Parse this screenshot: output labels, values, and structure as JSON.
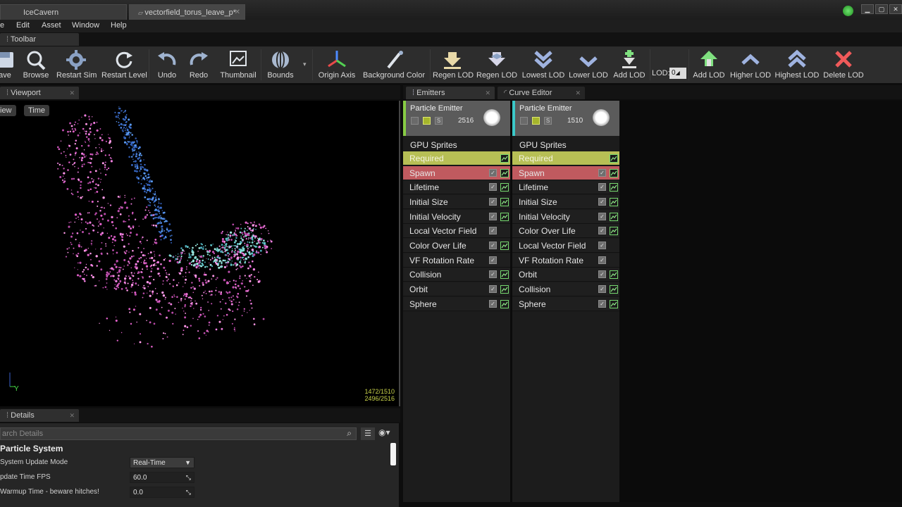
{
  "titlebar": {
    "tabs": [
      "IceCavern",
      "vectorfield_torus_leave_p*"
    ],
    "window_buttons": [
      "minimize",
      "maximize",
      "close"
    ]
  },
  "menu": {
    "items": [
      "e",
      "Edit",
      "Asset",
      "Window",
      "Help"
    ]
  },
  "toolbar": {
    "tab_label": "Toolbar",
    "buttons": [
      {
        "label": "ave",
        "icon": "save-icon"
      },
      {
        "label": "Browse",
        "icon": "browse-icon"
      },
      {
        "label": "Restart Sim",
        "icon": "restart-sim-icon"
      },
      {
        "label": "Restart Level",
        "icon": "restart-level-icon"
      },
      {
        "label": "Undo",
        "icon": "undo-icon"
      },
      {
        "label": "Redo",
        "icon": "redo-icon"
      },
      {
        "label": "Thumbnail",
        "icon": "thumbnail-icon"
      },
      {
        "label": "Bounds",
        "icon": "bounds-icon"
      },
      {
        "label": "Origin Axis",
        "icon": "origin-axis-icon"
      },
      {
        "label": "Background Color",
        "icon": "background-color-icon"
      },
      {
        "label": "Regen LOD",
        "icon": "regen-lod-icon"
      },
      {
        "label": "Regen LOD",
        "icon": "regen-lod-duplicate-icon"
      },
      {
        "label": "Lowest LOD",
        "icon": "lowest-lod-icon"
      },
      {
        "label": "Lower LOD",
        "icon": "lower-lod-icon"
      },
      {
        "label": "Add LOD",
        "icon": "add-lod-icon"
      },
      {
        "label": "Add LOD",
        "icon": "add-lod-higher-icon"
      },
      {
        "label": "Higher LOD",
        "icon": "higher-lod-icon"
      },
      {
        "label": "Highest LOD",
        "icon": "highest-lod-icon"
      },
      {
        "label": "Delete LOD",
        "icon": "delete-lod-icon"
      }
    ],
    "lod_label": "LOD:",
    "lod_value": "0"
  },
  "viewport": {
    "tab_label": "Viewport",
    "view_button": "iew",
    "time_button": "Time",
    "axis_label": "Y",
    "stats": [
      "1472/1510",
      "2496/2516"
    ]
  },
  "details": {
    "tab_label": "Details",
    "search_placeholder": "arch Details",
    "section_title": "Particle System",
    "properties": [
      {
        "label": "System Update Mode",
        "value": "Real-Time"
      },
      {
        "label": "pdate Time FPS",
        "value": "60.0"
      },
      {
        "label": "Warmup Time - beware hitches!",
        "value": "0.0"
      }
    ]
  },
  "emitters": {
    "tab_label": "Emitters",
    "curve_editor_tab": "Curve Editor",
    "columns": [
      {
        "title": "Particle Emitter",
        "count": "2516",
        "type": "GPU Sprites",
        "accent": "#88cc44",
        "modules": [
          {
            "label": "Required",
            "kind": "req",
            "check": false,
            "curve": true
          },
          {
            "label": "Spawn",
            "kind": "spawn",
            "check": true,
            "curve": true
          },
          {
            "label": "Lifetime",
            "kind": "",
            "check": true,
            "curve": true
          },
          {
            "label": "Initial Size",
            "kind": "",
            "check": true,
            "curve": true
          },
          {
            "label": "Initial Velocity",
            "kind": "",
            "check": true,
            "curve": true
          },
          {
            "label": "Local Vector Field",
            "kind": "",
            "check": true,
            "curve": false
          },
          {
            "label": "Color Over Life",
            "kind": "",
            "check": true,
            "curve": true
          },
          {
            "label": "VF Rotation Rate",
            "kind": "",
            "check": true,
            "curve": false
          },
          {
            "label": "Collision",
            "kind": "",
            "check": true,
            "curve": true
          },
          {
            "label": "Orbit",
            "kind": "",
            "check": true,
            "curve": true
          },
          {
            "label": "Sphere",
            "kind": "",
            "check": true,
            "curve": true
          }
        ]
      },
      {
        "title": "Particle Emitter",
        "count": "1510",
        "type": "GPU Sprites",
        "accent": "#3bc8c8",
        "modules": [
          {
            "label": "Required",
            "kind": "req",
            "check": false,
            "curve": true
          },
          {
            "label": "Spawn",
            "kind": "spawn",
            "check": true,
            "curve": true
          },
          {
            "label": "Lifetime",
            "kind": "",
            "check": true,
            "curve": true
          },
          {
            "label": "Initial Size",
            "kind": "",
            "check": true,
            "curve": true
          },
          {
            "label": "Initial Velocity",
            "kind": "",
            "check": true,
            "curve": true
          },
          {
            "label": "Color Over Life",
            "kind": "",
            "check": true,
            "curve": true
          },
          {
            "label": "Local Vector Field",
            "kind": "",
            "check": true,
            "curve": false
          },
          {
            "label": "VF Rotation Rate",
            "kind": "",
            "check": true,
            "curve": false
          },
          {
            "label": "Orbit",
            "kind": "",
            "check": true,
            "curve": true
          },
          {
            "label": "Collision",
            "kind": "",
            "check": true,
            "curve": true
          },
          {
            "label": "Sphere",
            "kind": "",
            "check": true,
            "curve": true
          }
        ]
      }
    ]
  }
}
